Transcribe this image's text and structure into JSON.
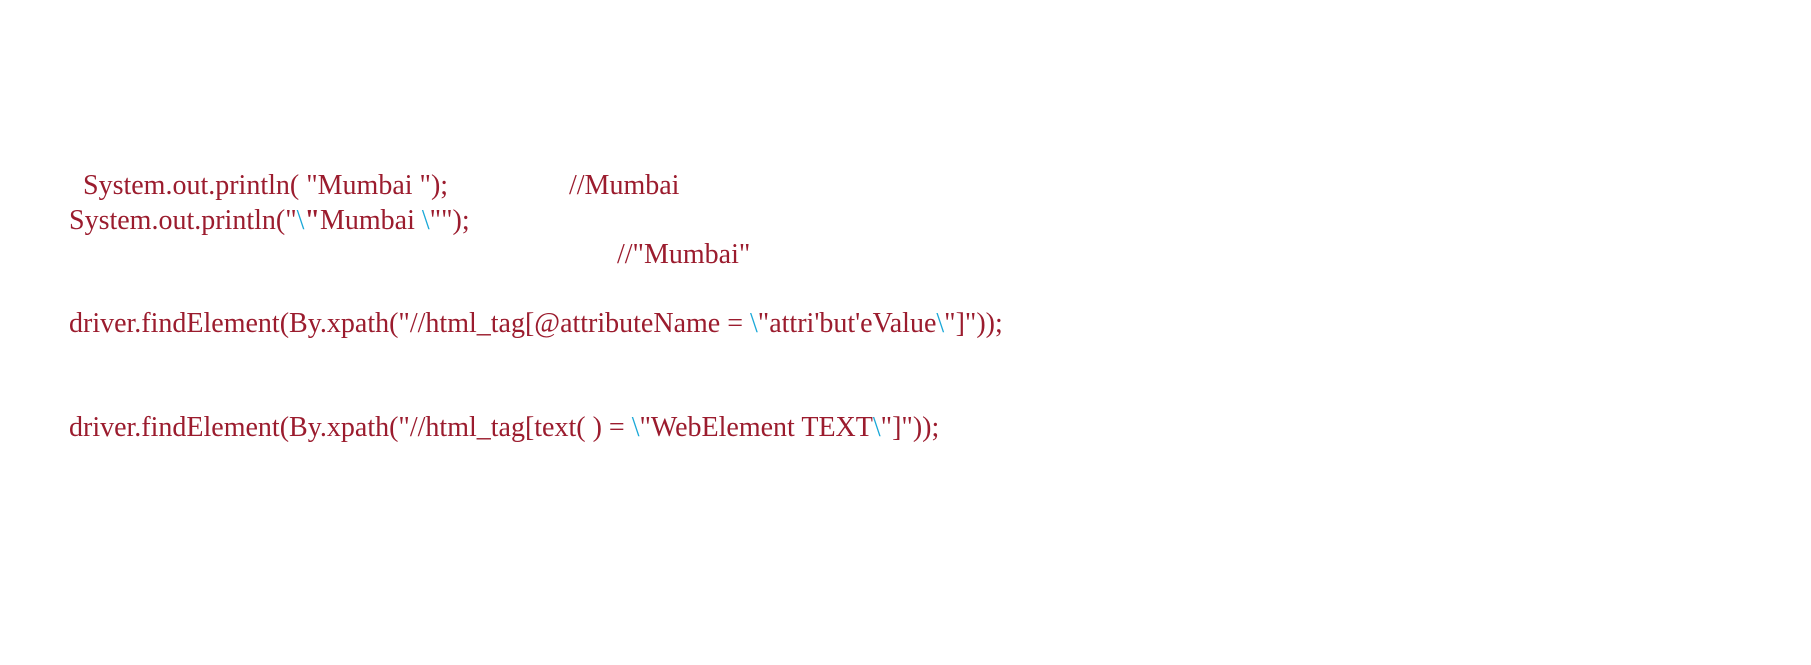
{
  "colors": {
    "code": "#9b1c2e",
    "escape": "#1aa8d8",
    "background": "#ffffff"
  },
  "lines": [
    {
      "parts": [
        "System.out.println( \"Mumbai \");"
      ],
      "comment": "//Mumbai"
    },
    {
      "parts": [
        "System.out.println(\"",
        "\\",
        "\"",
        "Mumbai ",
        "\\",
        "\"\");"
      ],
      "comment": "//\"Mumbai\""
    },
    {
      "parts": [
        "driver.findElement(By.xpath(\"//html_tag[@attributeName = ",
        "\\",
        "\"attri'but'eValue",
        "\\",
        "\"]\"));"
      ]
    },
    {
      "parts": [
        "driver.findElement(By.xpath(\"//html_tag[text( ) = ",
        "\\",
        "\"WebElement TEXT",
        "\\",
        "\"]\"));"
      ]
    }
  ]
}
